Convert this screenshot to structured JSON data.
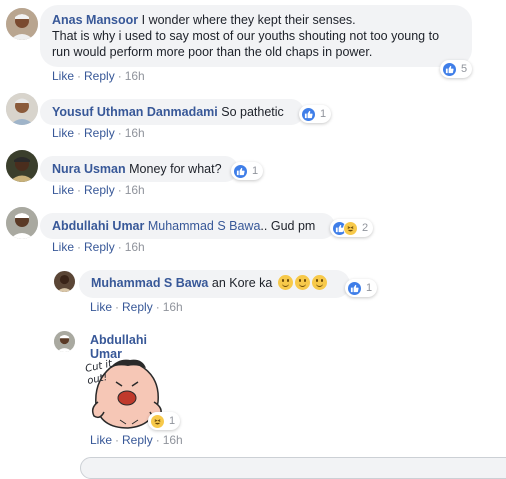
{
  "comments": [
    {
      "author": "Anas Mansoor",
      "text_lines": [
        "I wonder where they kept their senses.",
        "That is why i used to say most of our youths shouting not too young to",
        "run would perform more poor than the old chaps in power."
      ],
      "like_label": "Like",
      "reply_label": "Reply",
      "time": "16h",
      "reactions": [
        "like"
      ],
      "reaction_count": "5"
    },
    {
      "author": "Yousuf Uthman Danmadami",
      "text": "So pathetic",
      "like_label": "Like",
      "reply_label": "Reply",
      "time": "16h",
      "reactions": [
        "like"
      ],
      "reaction_count": "1"
    },
    {
      "author": "Nura Usman",
      "text": "Money for what?",
      "like_label": "Like",
      "reply_label": "Reply",
      "time": "16h",
      "reactions": [
        "like"
      ],
      "reaction_count": "1"
    },
    {
      "author": "Abdullahi Umar",
      "mention": "Muhammad S Bawa",
      "text": ".. Gud pm",
      "like_label": "Like",
      "reply_label": "Reply",
      "time": "16h",
      "reactions": [
        "like",
        "haha"
      ],
      "reaction_count": "2"
    }
  ],
  "replies": [
    {
      "author": "Muhammad S Bawa",
      "text": "an Kore ka",
      "emojis": [
        "smile-emoji",
        "smile-emoji",
        "smile-emoji"
      ],
      "like_label": "Like",
      "reply_label": "Reply",
      "time": "16h",
      "reactions": [
        "like"
      ],
      "reaction_count": "1"
    },
    {
      "author": "Abdullahi Umar",
      "sticker_text_1": "Cut it",
      "sticker_text_2": "out!",
      "like_label": "Like",
      "reply_label": "Reply",
      "time": "16h",
      "reactions": [
        "haha"
      ],
      "reaction_count": "1"
    }
  ],
  "colors": {
    "link": "#385898",
    "bubble": "#f2f3f5",
    "like_blue": "#3f7ee8",
    "meta_gray": "#90949c"
  }
}
